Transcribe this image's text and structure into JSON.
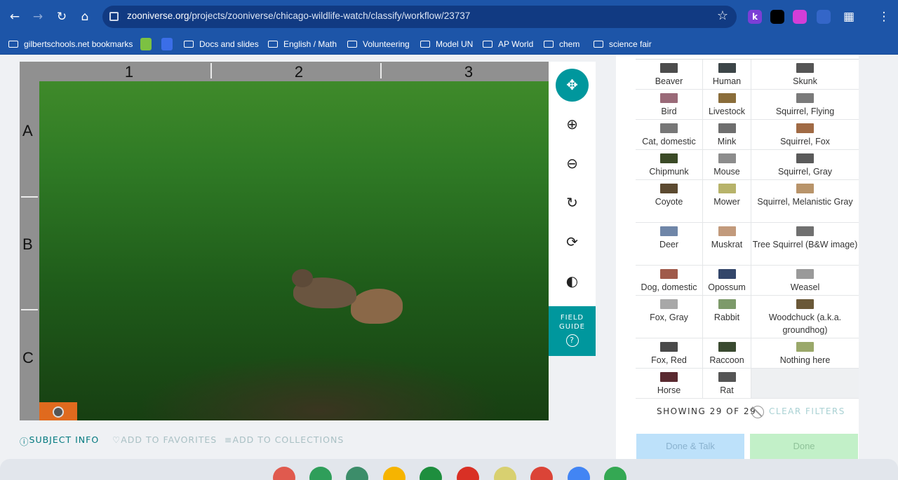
{
  "browser": {
    "url_host": "zooniverse.org",
    "url_path": "/projects/zooniverse/chicago-wildlife-watch/classify/workflow/23737",
    "extensions": [
      {
        "name": "k-extension",
        "letter": "k",
        "color": "#7b3fd6"
      },
      {
        "name": "spy-extension",
        "letter": "",
        "color": "#000000"
      },
      {
        "name": "video-extension",
        "letter": "",
        "color": "#d33ed8"
      },
      {
        "name": "screen-extension",
        "letter": "",
        "color": "#3466c8"
      }
    ]
  },
  "bookmarks": [
    {
      "label": "gilbertschools.net bookmarks",
      "type": "managed"
    },
    {
      "label": "",
      "type": "app-c"
    },
    {
      "label": "",
      "type": "app-blue"
    },
    {
      "label": "Docs and slides",
      "type": "folder"
    },
    {
      "label": "English / Math",
      "type": "folder"
    },
    {
      "label": "Volunteering",
      "type": "folder"
    },
    {
      "label": "Model UN",
      "type": "folder"
    },
    {
      "label": "AP World",
      "type": "folder"
    },
    {
      "label": "chem",
      "type": "folder"
    },
    {
      "label": "science fair",
      "type": "folder"
    }
  ],
  "subject": {
    "columns": [
      "1",
      "2",
      "3"
    ],
    "rows": [
      "A",
      "B",
      "C"
    ]
  },
  "toolbar": {
    "field_guide": "FIELD GUIDE",
    "field_guide_icon": "?"
  },
  "meta": {
    "subject_info": "SUBJECT INFO",
    "favorites": "ADD TO FAVORITES",
    "collections": "ADD TO COLLECTIONS"
  },
  "choices": [
    {
      "label": "Beaver",
      "thumb": "#4c4c4c"
    },
    {
      "label": "Human",
      "thumb": "#3c4548"
    },
    {
      "label": "Skunk",
      "thumb": "#555555"
    },
    {
      "label": "Bird",
      "thumb": "#9a6a78"
    },
    {
      "label": "Livestock",
      "thumb": "#8a6d3a"
    },
    {
      "label": "Squirrel, Flying",
      "thumb": "#7a7a7a"
    },
    {
      "label": "Cat, domestic",
      "thumb": "#777777"
    },
    {
      "label": "Mink",
      "thumb": "#6e6e6e"
    },
    {
      "label": "Squirrel, Fox",
      "thumb": "#a06a44"
    },
    {
      "label": "Chipmunk",
      "thumb": "#3b4a26"
    },
    {
      "label": "Mouse",
      "thumb": "#8c8c8c"
    },
    {
      "label": "Squirrel, Gray",
      "thumb": "#5a5a5a"
    },
    {
      "label": "Coyote",
      "thumb": "#5c4a30"
    },
    {
      "label": "Mower",
      "thumb": "#b7b36a"
    },
    {
      "label": "Squirrel, Melanistic Gray",
      "thumb": "#b8946a"
    },
    {
      "label": "Deer",
      "thumb": "#6f86a8"
    },
    {
      "label": "Muskrat",
      "thumb": "#c29a7c"
    },
    {
      "label": "Tree Squirrel (B&W image)",
      "thumb": "#707070"
    },
    {
      "label": "Dog, domestic",
      "thumb": "#a05a4a"
    },
    {
      "label": "Opossum",
      "thumb": "#33466a"
    },
    {
      "label": "Weasel",
      "thumb": "#9a9a9a"
    },
    {
      "label": "Fox, Gray",
      "thumb": "#a8a8a8"
    },
    {
      "label": "Rabbit",
      "thumb": "#7d9a6a"
    },
    {
      "label": "Woodchuck (a.k.a. groundhog)",
      "thumb": "#6a5838"
    },
    {
      "label": "Fox, Red",
      "thumb": "#4a4a4a"
    },
    {
      "label": "Raccoon",
      "thumb": "#3a4a30"
    },
    {
      "label": "Nothing here",
      "thumb": "#9aa86a"
    },
    {
      "label": "Horse",
      "thumb": "#5a2a30"
    },
    {
      "label": "Rat",
      "thumb": "#555555"
    }
  ],
  "filters": {
    "showing": "SHOWING 29 OF 29",
    "clear": "CLEAR FILTERS"
  },
  "actions": {
    "done_talk": "Done & Talk",
    "done": "Done"
  },
  "shelf": {
    "apps": [
      {
        "name": "palette-app-icon",
        "color": "#e05a4e"
      },
      {
        "name": "classroom-app-icon",
        "color": "#2f9e5a"
      },
      {
        "name": "sites-app-icon",
        "color": "#3c8d6a"
      },
      {
        "name": "keep-app-icon",
        "color": "#f6b400"
      },
      {
        "name": "drive-app-icon",
        "color": "#1e8e3e"
      },
      {
        "name": "gmail-app-icon",
        "color": "#d93025"
      },
      {
        "name": "notes-app-icon",
        "color": "#d8d070"
      },
      {
        "name": "chrome-app-icon",
        "color": "#db4437"
      },
      {
        "name": "docs-app-icon",
        "color": "#4285f4"
      },
      {
        "name": "play-app-icon",
        "color": "#34a853"
      }
    ]
  }
}
